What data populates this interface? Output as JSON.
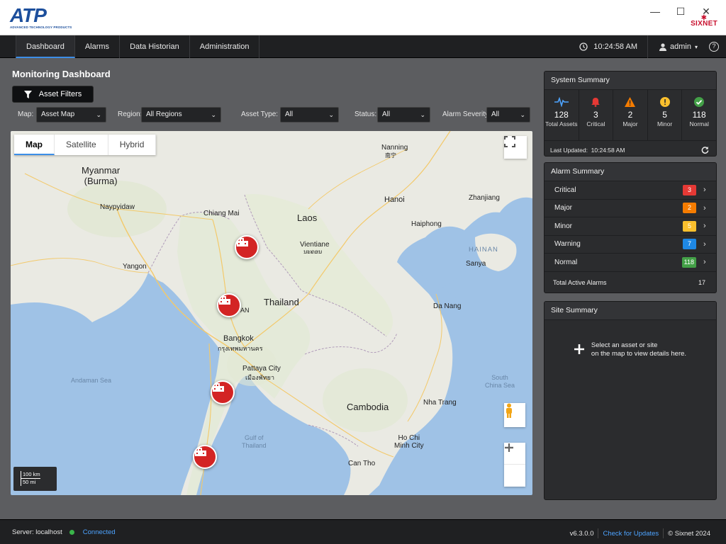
{
  "app": {
    "logo_text": "ATP",
    "logo_subtitle": "ADVANCED TECHNOLOGY PRODUCTS",
    "brand": "SIXNET"
  },
  "window_controls": {
    "minimize": "—",
    "maximize": "☐",
    "close": "✕"
  },
  "nav": {
    "tabs": [
      {
        "label": "Dashboard",
        "active": true
      },
      {
        "label": "Alarms",
        "active": false
      },
      {
        "label": "Data Historian",
        "active": false
      },
      {
        "label": "Administration",
        "active": false
      }
    ],
    "time": "10:24:58 AM",
    "user": "admin",
    "help": "?"
  },
  "page": {
    "title": "Monitoring Dashboard",
    "asset_filters_label": "Asset Filters"
  },
  "filters": {
    "map_label": "Map:",
    "map_value": "Asset Map",
    "region_label": "Region:",
    "region_value": "All Regions",
    "asset_type_label": "Asset Type:",
    "asset_type_value": "All",
    "status_label": "Status:",
    "status_value": "All",
    "severity_label": "Alarm Severity:",
    "severity_value": "All"
  },
  "map": {
    "tabs": [
      "Map",
      "Satellite",
      "Hybrid"
    ],
    "active_tab": "Map",
    "scale_km": "100 km",
    "scale_mi": "50 mi",
    "labels": {
      "myanmar": "Myanmar\n(Burma)",
      "naypyidaw": "Naypyidaw",
      "yangon": "Yangon",
      "andaman": "Andaman Sea",
      "chiangmai": "Chiang Mai",
      "laos": "Laos",
      "vientiane": "Vientiane",
      "vientiane_local": "ນະຄອນ",
      "thailand": "Thailand",
      "bangkok": "Bangkok",
      "bangkok_local": "กรุงเทพมหานคร",
      "pattaya": "Pattaya City",
      "pattaya_local": "เมืองพัทยา",
      "gulf": "Gulf of\nThailand",
      "cambodia": "Cambodia",
      "nanning": "Nanning",
      "nanning_local": "南宁",
      "hanoi": "Hanoi",
      "haiphong": "Haiphong",
      "zhanjiang": "Zhanjiang",
      "hainan": "HAINAN",
      "sanya": "Sanya",
      "danang": "Da Nang",
      "nhatrang": "Nha Trang",
      "hcmc": "Ho Chi\nMinh City",
      "canthho": "Can Tho",
      "southchina": "South\nChina Sea",
      "partial": "AN"
    }
  },
  "system_summary": {
    "title": "System Summary",
    "cells": [
      {
        "value": "128",
        "label": "Total Assets",
        "icon": "pulse-icon",
        "color": "#4da3ff"
      },
      {
        "value": "3",
        "label": "Critical",
        "icon": "bell-icon",
        "color": "#e53935"
      },
      {
        "value": "2",
        "label": "Major",
        "icon": "warning-triangle-icon",
        "color": "#f57c00"
      },
      {
        "value": "5",
        "label": "Minor",
        "icon": "exclamation-circle-icon",
        "color": "#fbc02d"
      },
      {
        "value": "118",
        "label": "Normal",
        "icon": "check-circle-icon",
        "color": "#43a047"
      }
    ],
    "last_updated_label": "Last Updated:",
    "last_updated": "10:24:58 AM"
  },
  "alarm_summary": {
    "title": "Alarm Summary",
    "rows": [
      {
        "name": "Critical",
        "count": "3",
        "color": "#e53935"
      },
      {
        "name": "Major",
        "count": "2",
        "color": "#f57c00"
      },
      {
        "name": "Minor",
        "count": "5",
        "color": "#fbc02d"
      },
      {
        "name": "Warning",
        "count": "7",
        "color": "#1e88e5"
      },
      {
        "name": "Normal",
        "count": "118",
        "color": "#43a047"
      }
    ],
    "total_label": "Total Active Alarms",
    "total": "17"
  },
  "site_summary": {
    "title": "Site Summary",
    "message_line1": "Select an asset or site",
    "message_line2": "on the map to view details here."
  },
  "status_bar": {
    "server": "Server: localhost",
    "connection": "Connected",
    "version": "v6.3.0.0",
    "check_updates": "Check for Updates",
    "copyright": "© Sixnet 2024"
  }
}
